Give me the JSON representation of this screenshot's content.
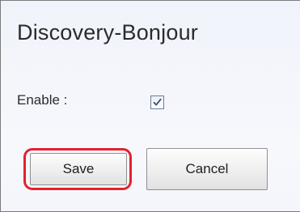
{
  "section": {
    "title": "Discovery-Bonjour"
  },
  "form": {
    "enable_label": "Enable :",
    "enable_checked": true
  },
  "actions": {
    "save_label": "Save",
    "cancel_label": "Cancel",
    "highlight_color": "#e3212f"
  },
  "icons": {
    "checkbox_check": "checkmark-icon"
  }
}
